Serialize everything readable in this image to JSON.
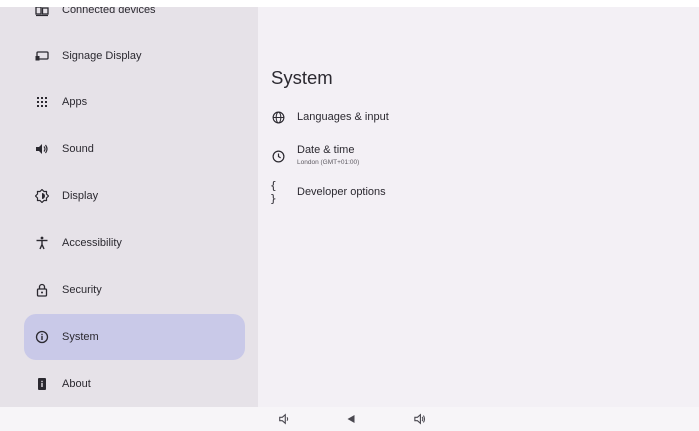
{
  "sidebar": {
    "items": [
      {
        "label": "Connected devices",
        "icon": "connected-devices-icon"
      },
      {
        "label": "Signage Display",
        "icon": "display-screen-icon"
      },
      {
        "label": "Apps",
        "icon": "apps-grid-icon"
      },
      {
        "label": "Sound",
        "icon": "speaker-icon"
      },
      {
        "label": "Display",
        "icon": "brightness-icon"
      },
      {
        "label": "Accessibility",
        "icon": "accessibility-icon"
      },
      {
        "label": "Security",
        "icon": "lock-icon"
      },
      {
        "label": "System",
        "icon": "info-icon",
        "selected": true
      },
      {
        "label": "About",
        "icon": "device-info-icon"
      }
    ]
  },
  "main": {
    "title": "System",
    "rows": [
      {
        "title": "Languages & input",
        "icon": "globe-icon"
      },
      {
        "title": "Date & time",
        "subtitle": "London (GMT+01:00)",
        "icon": "clock-icon"
      },
      {
        "title": "Developer options",
        "icon": "braces-icon"
      }
    ]
  },
  "navbar": {
    "buttons": [
      "volume-down-icon",
      "back-icon",
      "volume-up-icon"
    ]
  },
  "colors": {
    "sidebar_bg": "#e6e2e8",
    "selected_bg": "#c9c9e8",
    "main_bg": "#f3f0f5"
  }
}
